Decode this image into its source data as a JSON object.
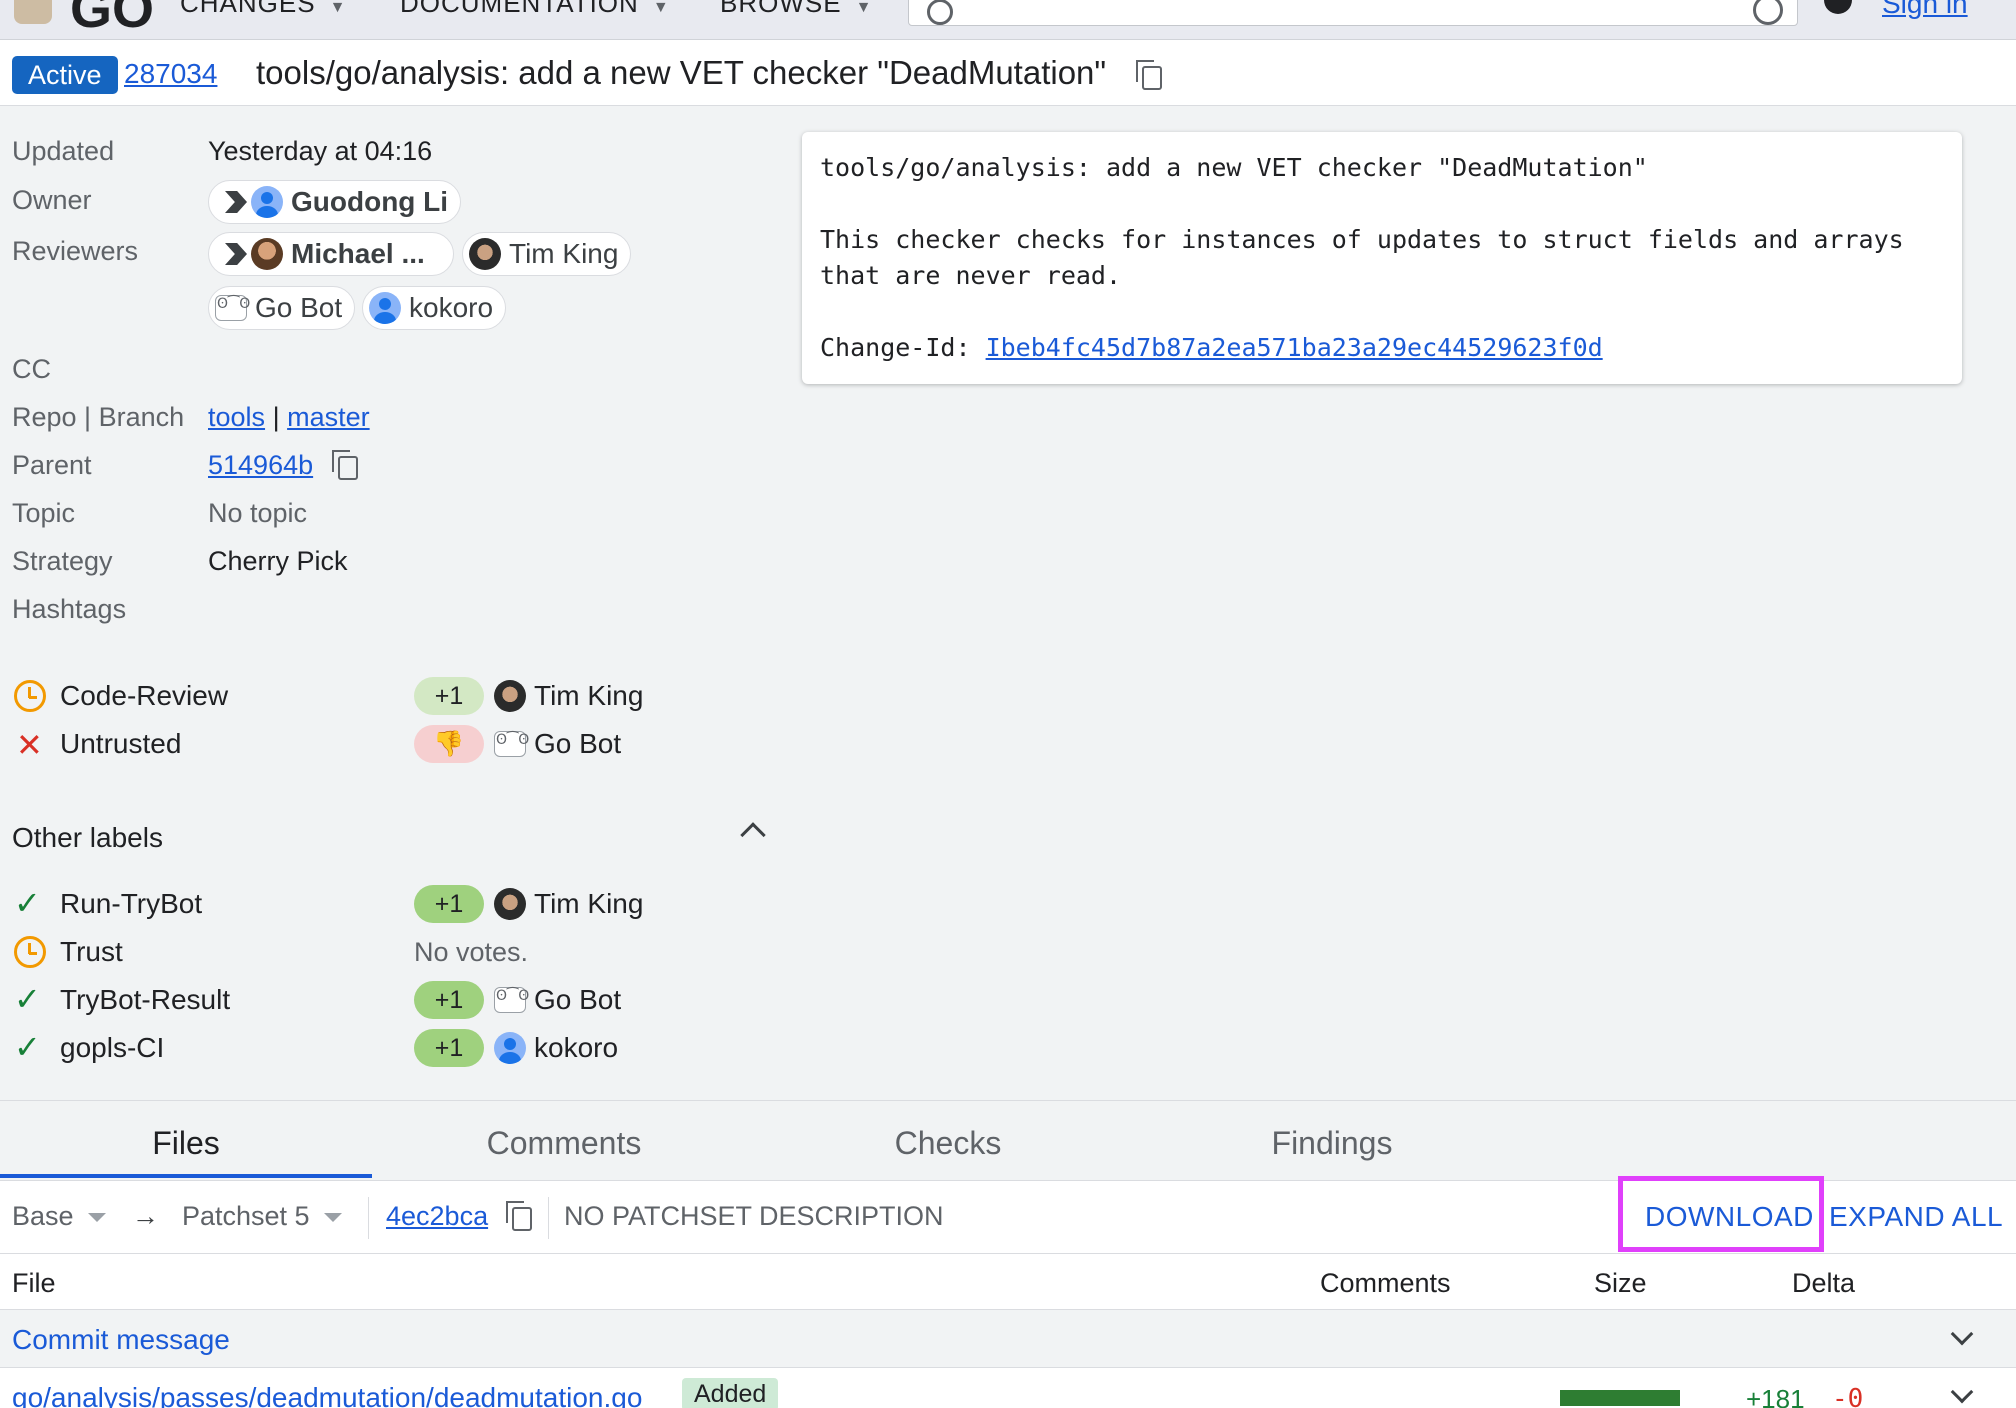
{
  "topbar": {
    "logo": "GO",
    "nav": [
      "CHANGES",
      "DOCUMENTATION",
      "BROWSE"
    ],
    "search_placeholder": "",
    "sign_in": "Sign in"
  },
  "header": {
    "status": "Active",
    "change_number": "287034",
    "title": "tools/go/analysis: add a new VET checker \"DeadMutation\""
  },
  "metadata": {
    "updated_label": "Updated",
    "updated_value": "Yesterday at 04:16",
    "owner_label": "Owner",
    "owner": "Guodong Li",
    "reviewers_label": "Reviewers",
    "reviewers": [
      "Michael ...",
      "Tim King",
      "Go Bot",
      "kokoro"
    ],
    "cc_label": "CC",
    "repo_branch_label": "Repo | Branch",
    "repo": "tools",
    "branch_sep": "|",
    "branch": "master",
    "parent_label": "Parent",
    "parent": "514964b",
    "topic_label": "Topic",
    "topic": "No topic",
    "strategy_label": "Strategy",
    "strategy": "Cherry Pick",
    "hashtags_label": "Hashtags"
  },
  "commit_message": {
    "subject": "tools/go/analysis: add a new VET checker \"DeadMutation\"",
    "body_line1": "This checker checks for instances of updates to struct fields and arrays",
    "body_line2": "that are never read.",
    "change_id_label": "Change-Id: ",
    "change_id": "Ibeb4fc45d7b87a2ea571ba23a29ec44529623f0d"
  },
  "submit_requirements": [
    {
      "name": "Code-Review",
      "status": "pending",
      "vote": "+1",
      "voter": "Tim King"
    },
    {
      "name": "Untrusted",
      "status": "failed",
      "vote": "👎",
      "voter": "Go Bot"
    }
  ],
  "other_labels_title": "Other labels",
  "other_labels": [
    {
      "name": "Run-TryBot",
      "status": "ok",
      "vote": "+1",
      "voter": "Tim King"
    },
    {
      "name": "Trust",
      "status": "pending",
      "no_votes": "No votes."
    },
    {
      "name": "TryBot-Result",
      "status": "ok",
      "vote": "+1",
      "voter": "Go Bot"
    },
    {
      "name": "gopls-CI",
      "status": "ok",
      "vote": "+1",
      "voter": "kokoro"
    }
  ],
  "tabs": [
    "Files",
    "Comments",
    "Checks",
    "Findings"
  ],
  "patchset_bar": {
    "base": "Base",
    "arrow": "→",
    "patchset": "Patchset 5",
    "commit": "4ec2bca",
    "description": "NO PATCHSET DESCRIPTION",
    "download": "DOWNLOAD",
    "expand_all": "EXPAND ALL"
  },
  "file_list": {
    "columns": {
      "file": "File",
      "comments": "Comments",
      "size": "Size",
      "delta": "Delta"
    },
    "rows": [
      {
        "name": "Commit message"
      },
      {
        "name": "go/analysis/passes/deadmutation/deadmutation.go",
        "badge": "Added",
        "added": "+181",
        "removed": "-0"
      }
    ]
  },
  "colors": {
    "accent": "#1a5ad7",
    "active_badge": "#1565c0",
    "highlight": "#e040fb",
    "vote_positive": "#9fd17e"
  }
}
